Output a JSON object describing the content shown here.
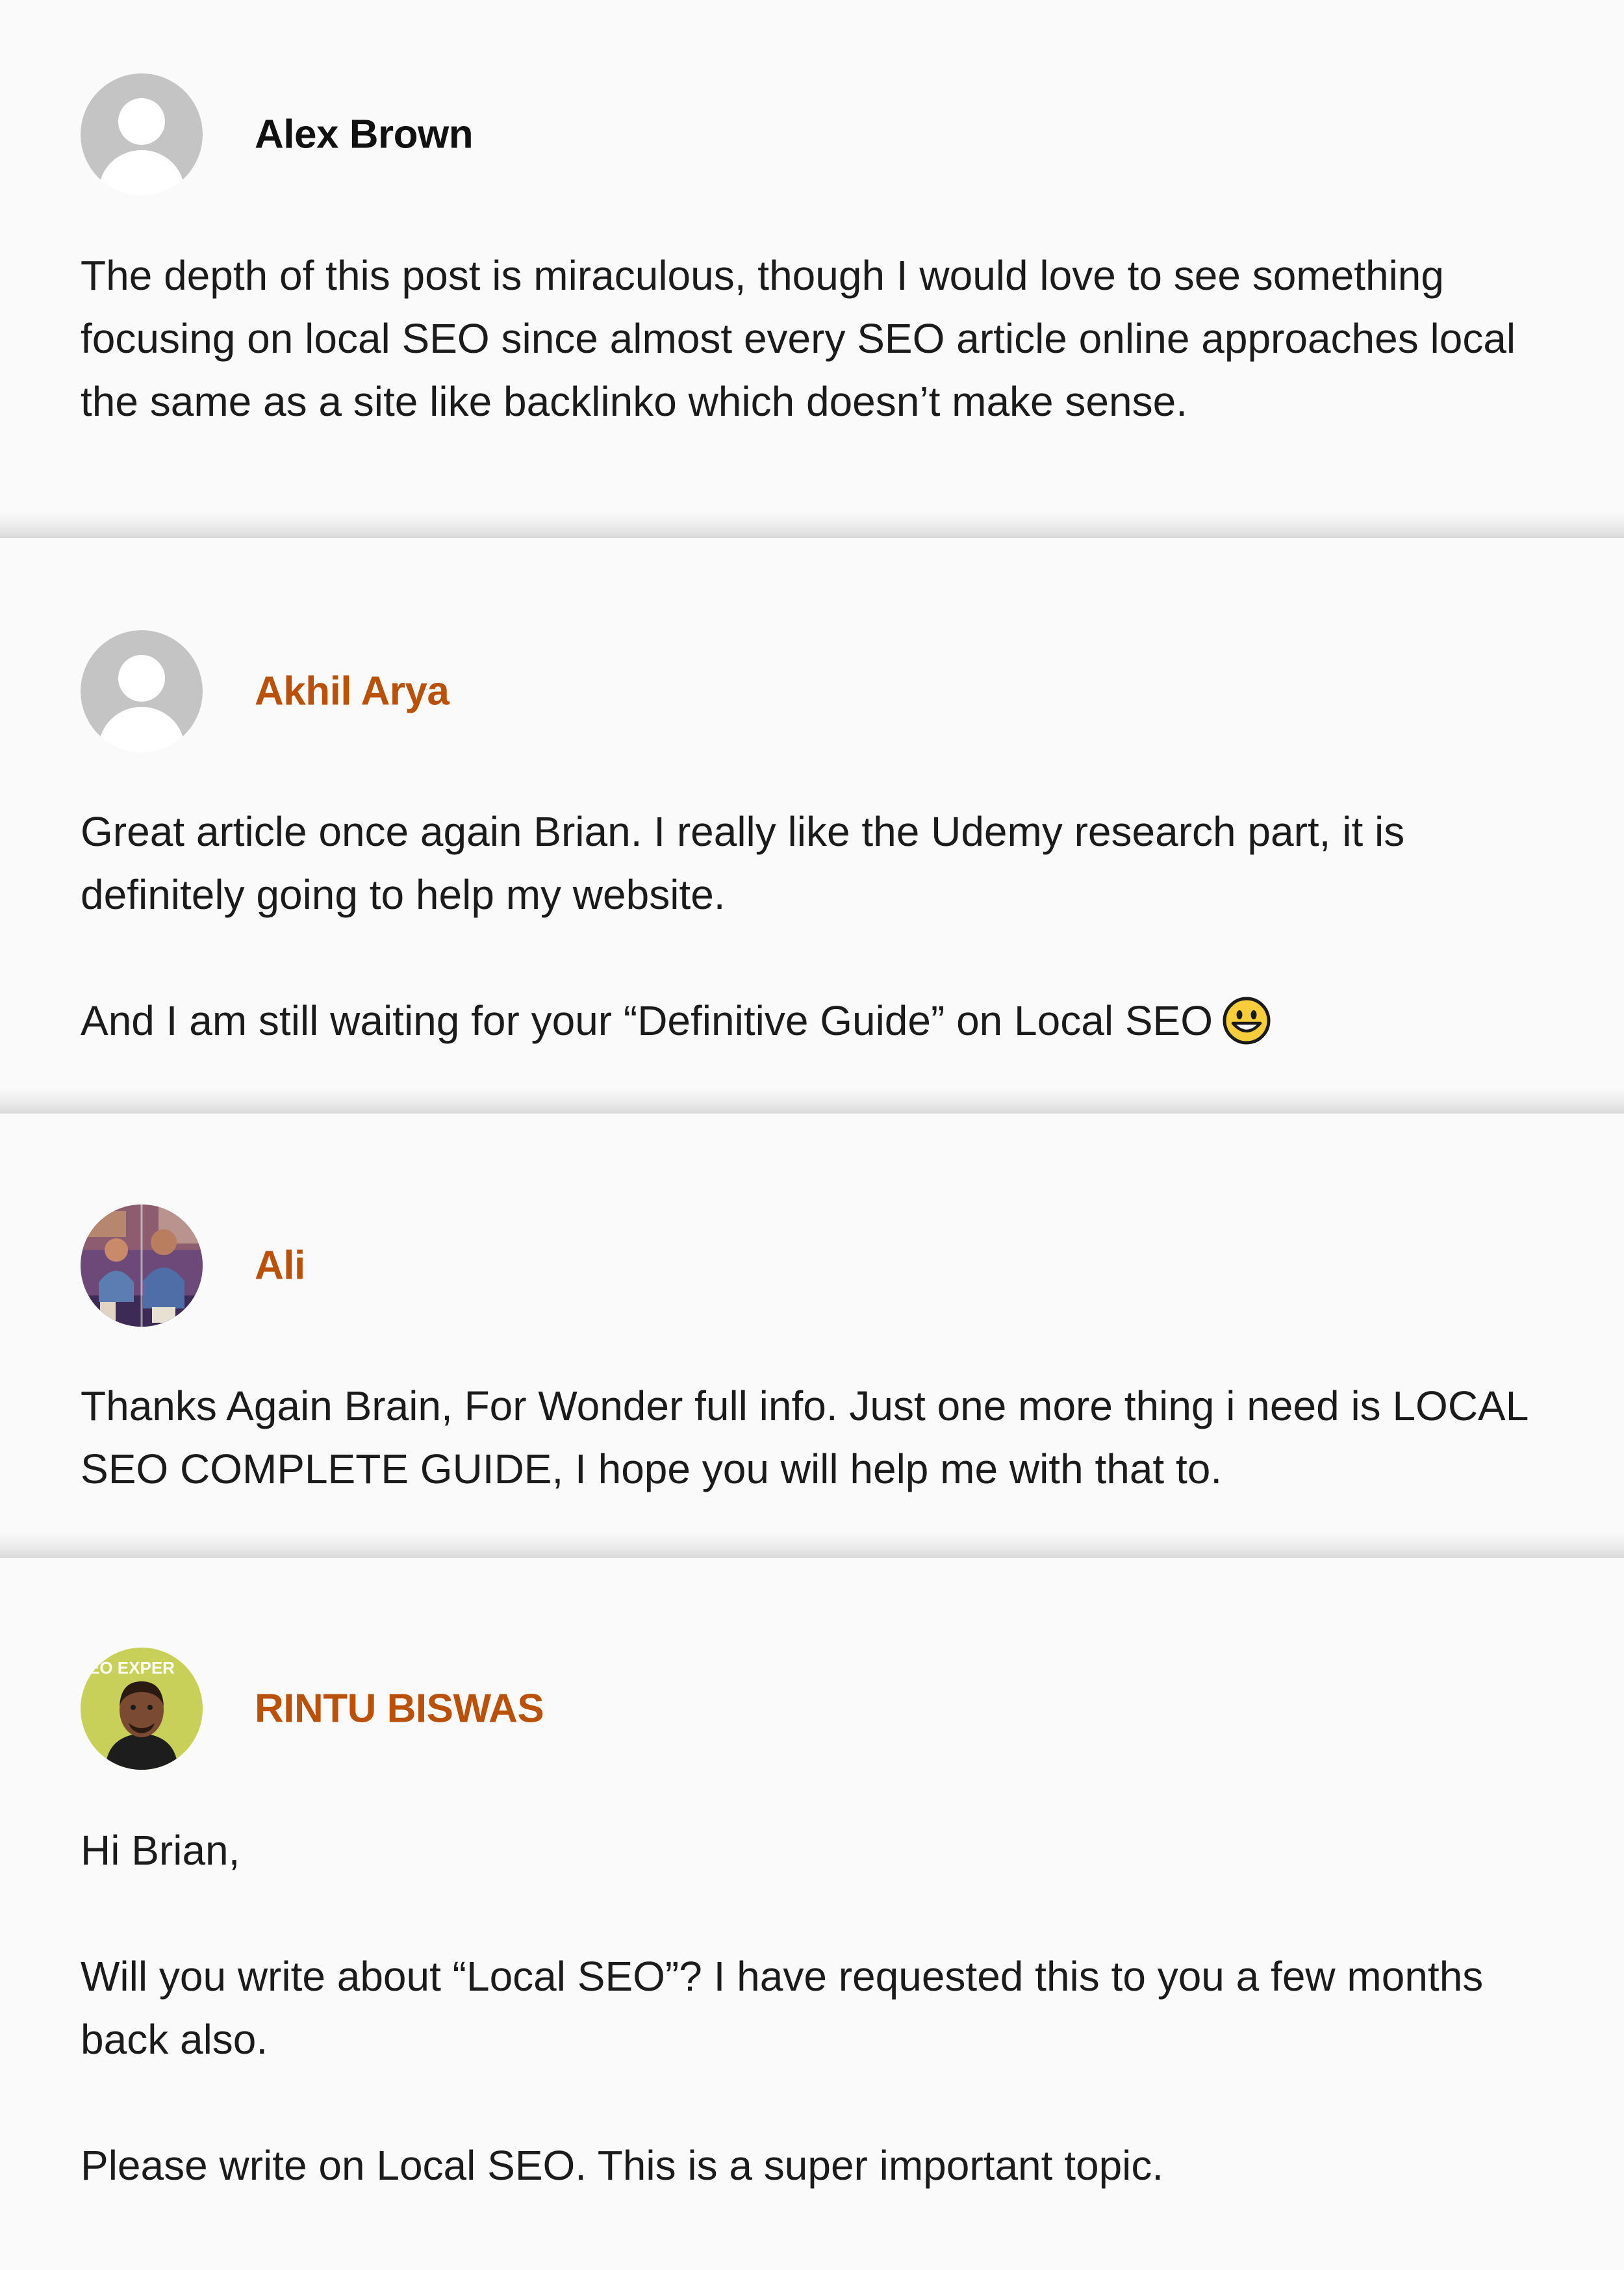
{
  "comments": [
    {
      "author": "Alex Brown",
      "author_is_link": false,
      "avatar": "default-avatar-icon",
      "paragraphs": [
        "The depth of this post is miraculous, though I would love to see something focusing on local SEO since almost every SEO article online approaches local the same as a site like backlinko which doesn’t make sense."
      ]
    },
    {
      "author": "Akhil Arya",
      "author_is_link": true,
      "avatar": "default-avatar-icon",
      "paragraphs": [
        "Great article once again Brian. I really like the Udemy research part, it is definitely going to help my website.",
        "And I am still waiting for your “Definitive Guide” on Local SEO"
      ],
      "emoji": "grinning-face-emoji"
    },
    {
      "author": "Ali",
      "author_is_link": true,
      "avatar": "photo-avatar",
      "paragraphs": [
        "Thanks Again Brain, For Wonder full info. Just one more thing i need is LOCAL SEO COMPLETE GUIDE, I hope you will help me with that to."
      ]
    },
    {
      "author": "RINTU BISWAS",
      "author_is_link": true,
      "avatar": "photo-avatar",
      "avatar_badge_text": "EO EXPER",
      "paragraphs": [
        "Hi Brian,",
        "Will you write about “Local SEO”? I have requested this to you a few months back also.",
        "Please write on Local SEO. This is a super important topic."
      ]
    }
  ],
  "colors": {
    "background": "#fafafa",
    "author_link": "#b9510a",
    "author_plain": "#111111",
    "text": "#1b1b1b",
    "avatar_default": "#c4c4c4"
  }
}
